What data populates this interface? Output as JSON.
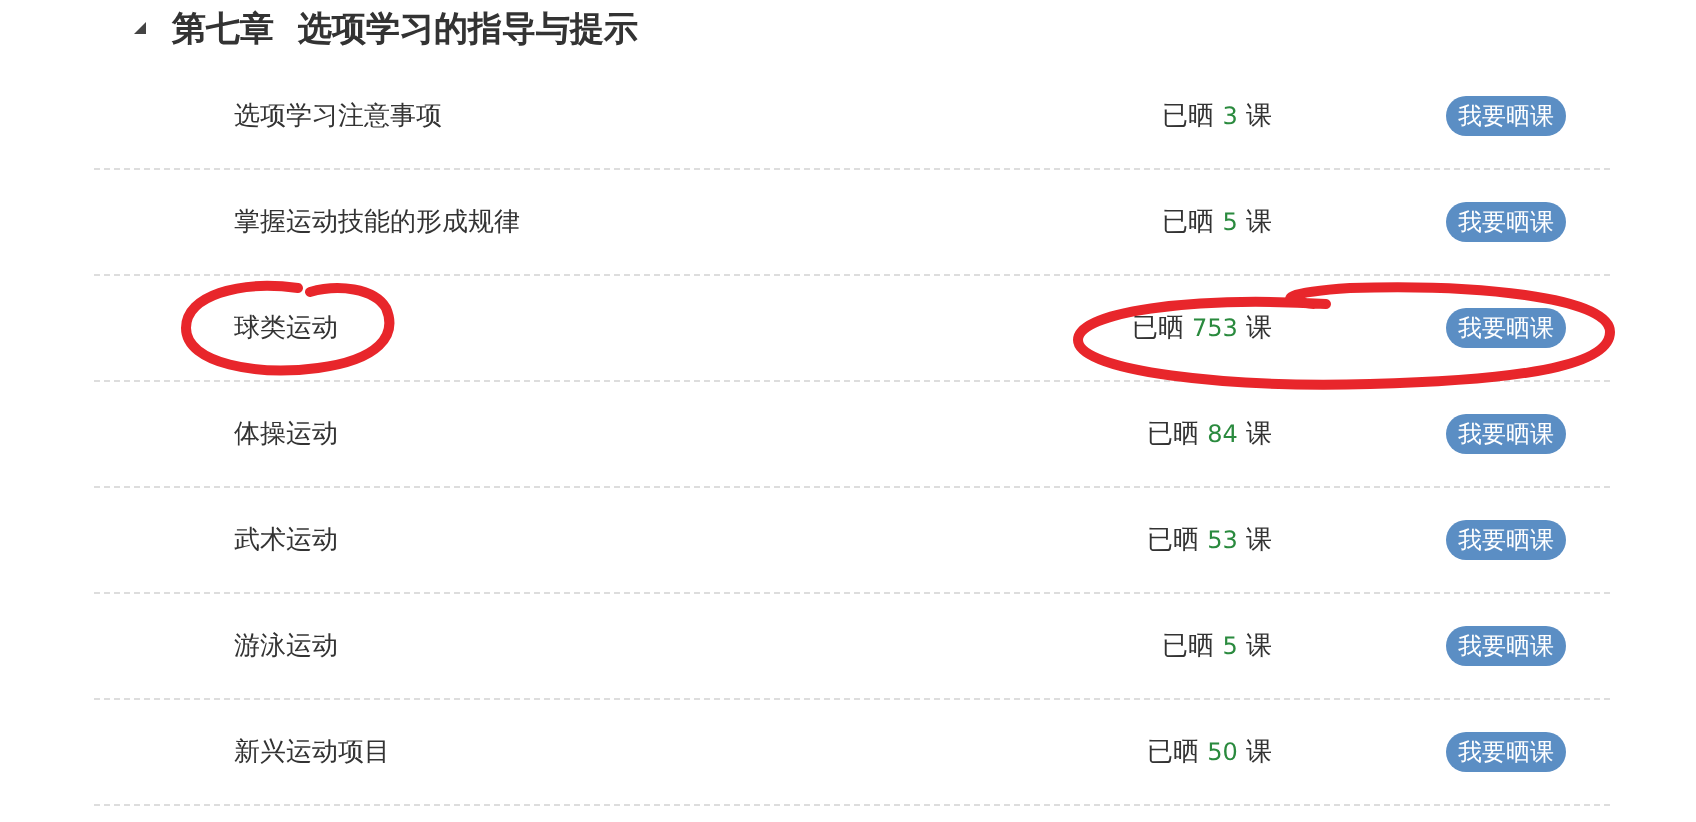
{
  "chapter": {
    "title": "第七章  选项学习的指导与提示",
    "expanded": true
  },
  "rows": [
    {
      "name": "选项学习注意事项",
      "count": {
        "before": "已晒",
        "number": "3",
        "after": "课"
      },
      "button": "我要晒课",
      "circled": false
    },
    {
      "name": "掌握运动技能的形成规律",
      "count": {
        "before": "已晒",
        "number": "5",
        "after": "课"
      },
      "button": "我要晒课",
      "circled": false
    },
    {
      "name": "球类运动",
      "count": {
        "before": "已晒",
        "number": "753",
        "after": "课"
      },
      "button": "我要晒课",
      "circled": true
    },
    {
      "name": "体操运动",
      "count": {
        "before": "已晒",
        "number": "84",
        "after": "课"
      },
      "button": "我要晒课",
      "circled": false
    },
    {
      "name": "武术运动",
      "count": {
        "before": "已晒",
        "number": "53",
        "after": "课"
      },
      "button": "我要晒课",
      "circled": false
    },
    {
      "name": "游泳运动",
      "count": {
        "before": "已晒",
        "number": "5",
        "after": "课"
      },
      "button": "我要晒课",
      "circled": false
    },
    {
      "name": "新兴运动项目",
      "count": {
        "before": "已晒",
        "number": "50",
        "after": "课"
      },
      "button": "我要晒课",
      "circled": false
    }
  ]
}
